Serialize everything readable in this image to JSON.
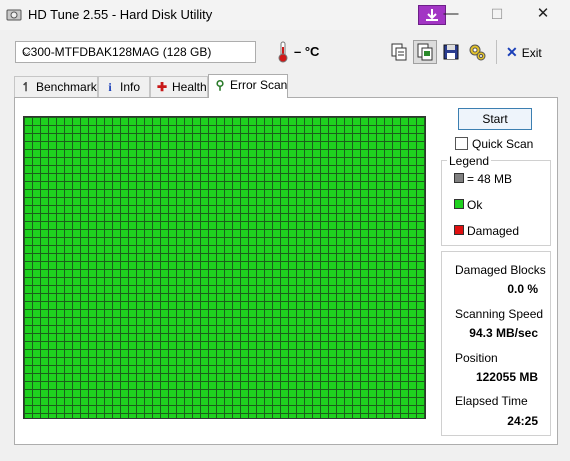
{
  "window": {
    "title": "HD Tune 2.55 - Hard Disk Utility",
    "minimize": "—",
    "maximize": "☐",
    "close": "✕"
  },
  "toolbar": {
    "drive": "C300-MTFDBAK128MAG (128 GB)",
    "temperature": "– °C",
    "exit_label": "Exit"
  },
  "tabs": [
    {
      "label": "Benchmark",
      "icon": "benchmark-icon",
      "active": false
    },
    {
      "label": "Info",
      "icon": "info-icon",
      "active": false
    },
    {
      "label": "Health",
      "icon": "health-cross-icon",
      "active": false
    },
    {
      "label": "Error Scan",
      "icon": "magnifier-icon",
      "active": true
    }
  ],
  "scan": {
    "start_label": "Start",
    "quick_scan_label": "Quick Scan",
    "quick_scan_checked": false
  },
  "legend": {
    "title": "Legend",
    "items": [
      {
        "label": "= 48 MB",
        "color": "#808080"
      },
      {
        "label": "Ok",
        "color": "#1fd11f"
      },
      {
        "label": "Damaged",
        "color": "#e01010"
      }
    ]
  },
  "stats": {
    "damaged_blocks_label": "Damaged Blocks",
    "damaged_blocks_value": "0.0 %",
    "speed_label": "Scanning Speed",
    "speed_value": "94.3 MB/sec",
    "position_label": "Position",
    "position_value": "122055 MB",
    "elapsed_label": "Elapsed Time",
    "elapsed_value": "24:25"
  },
  "colors": {
    "ok_block": "#1fd11f",
    "grid_line": "#1b5e1b",
    "accent": "#a235c4"
  }
}
